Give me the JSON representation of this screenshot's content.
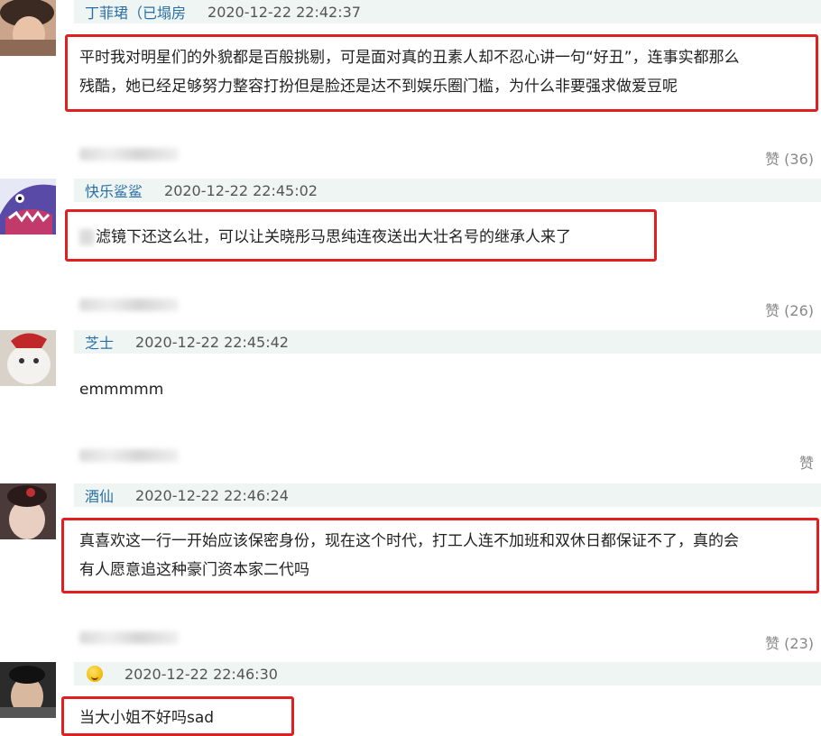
{
  "comments": [
    {
      "username": "丁菲珺（已塌房",
      "timestamp": "2020-12-22 22:42:37",
      "text_line1": "平时我对明星们的外貌都是百般挑剔，可是面对真的丑素人却不忍心讲一句“好丑”，连事实都那么",
      "text_line2": "残酷，她已经足够努力整容打扮但是脸还是达不到娱乐圈门槛，为什么非要强求做爱豆呢",
      "like": "赞 (36)"
    },
    {
      "username": "快乐鲨鲨",
      "timestamp": "2020-12-22 22:45:02",
      "text_line1": "滤镜下还这么壮，可以让关晓彤马思纯连夜送出大壮名号的继承人来了",
      "like": "赞 (26)"
    },
    {
      "username": "芝士",
      "timestamp": "2020-12-22 22:45:42",
      "text_line1": "emmmmm",
      "like": "赞"
    },
    {
      "username": "酒仙",
      "timestamp": "2020-12-22 22:46:24",
      "text_line1": "真喜欢这一行一开始应该保密身份，现在这个时代，打工人连不加班和双休日都保证不了，真的会",
      "text_line2": "有人愿意追这种豪门资本家二代吗",
      "like": "赞 (23)"
    },
    {
      "username": "",
      "timestamp": "2020-12-22 22:46:30",
      "text_line1": "当大小姐不好吗sad"
    }
  ],
  "colors": {
    "username": "#2a6fa6",
    "meta_bg": "#eef5f3",
    "highlight": "#e02020",
    "like": "#888888"
  },
  "icons": [
    "avatar-photo",
    "avatar-shark-cartoon",
    "avatar-cat",
    "avatar-photo",
    "avatar-photo",
    "laughing-emoji-icon"
  ]
}
